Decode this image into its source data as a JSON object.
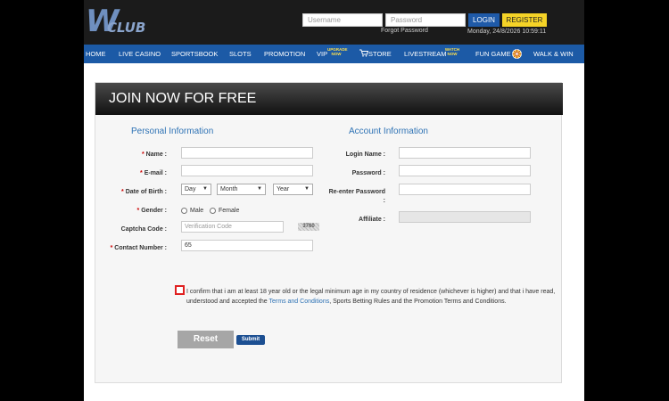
{
  "header": {
    "logo_main": "W",
    "logo_sub": "CLUB",
    "username_placeholder": "Username",
    "password_placeholder": "Password",
    "login_label": "LOGIN",
    "register_label": "REGISTER",
    "forgot_password": "Forgot Password",
    "datetime": "Monday, 24/8/2026 10:59:11",
    "colors": {
      "login": "#1f5aa8",
      "register": "#f5d327"
    }
  },
  "nav": {
    "items": [
      {
        "label": "HOME"
      },
      {
        "label": "LIVE CASINO"
      },
      {
        "label": "SPORTSBOOK"
      },
      {
        "label": "SLOTS"
      },
      {
        "label": "PROMOTION"
      },
      {
        "label": "VIP",
        "badge": "UPGRADE NOW"
      },
      {
        "label": "STORE",
        "icon": "cart-icon"
      },
      {
        "label": "LIVESTREAM",
        "badge": "WATCH NOW"
      },
      {
        "label": "FUN GAME",
        "icon": "wheel-icon"
      },
      {
        "label": "WALK & WIN"
      }
    ],
    "color": "#1c5aa6"
  },
  "form": {
    "title": "JOIN NOW FOR FREE",
    "personal": {
      "heading": "Personal Information",
      "name_label": "Name :",
      "email_label": "E-mail :",
      "dob_label": "Date of Birth :",
      "dob_day": "Day",
      "dob_month": "Month",
      "dob_year": "Year",
      "gender_label": "Gender :",
      "gender_male": "Male",
      "gender_female": "Female",
      "captcha_label": "Captcha Code :",
      "captcha_placeholder": "Verification Code",
      "captcha_image_text": "3760",
      "contact_label": "Contact Number :",
      "contact_value": "65"
    },
    "account": {
      "heading": "Account Information",
      "login_label": "Login Name :",
      "password_label": "Password :",
      "reenter_label": "Re-enter Password",
      "reenter_colon": ":",
      "affiliate_label": "Affiliate :"
    },
    "confirm": {
      "text_before": "I confirm that i am at least 18 year old or the legal minimum age in my country of residence (whichever is higher) and that i have read, understood and accepted the ",
      "link": "Terms and Conditions",
      "text_after": ", Sports Betting Rules and the Promotion Terms and Conditions."
    },
    "reset_label": "Reset",
    "submit_label": "Submit"
  }
}
